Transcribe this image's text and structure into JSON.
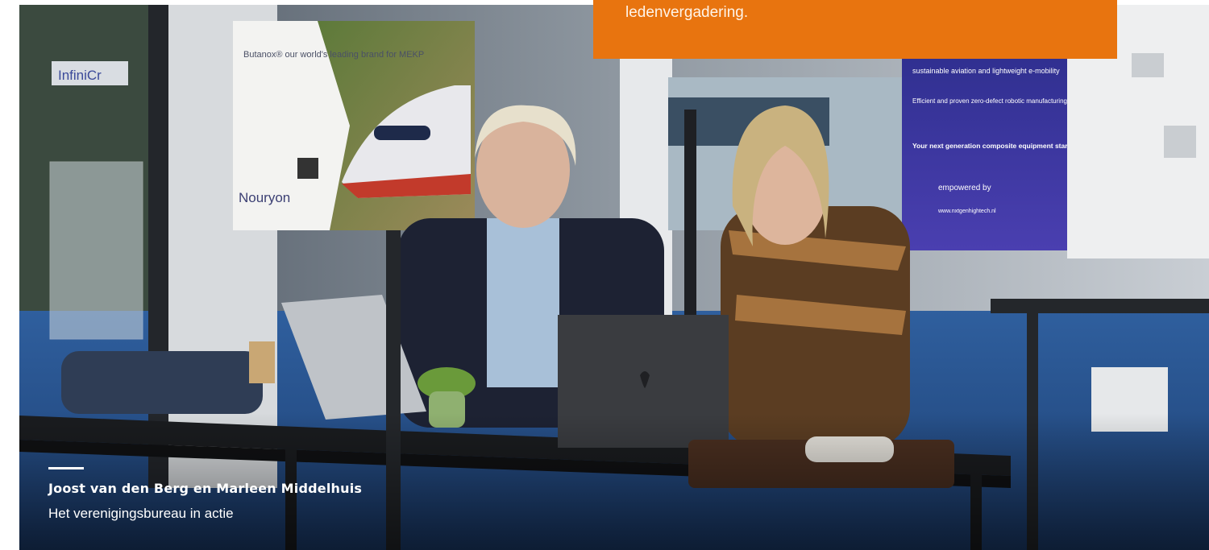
{
  "banner": {
    "text": "ledenvergadering."
  },
  "photo": {
    "nouryon_sign": {
      "headline": "Butanox® our world's leading brand for MEKP",
      "brand": "Nouryon"
    },
    "booth_panel": {
      "line1": "sustainable aviation and lightweight e-mobility",
      "line2": "Efficient and proven zero-defect robotic manufacturing",
      "tagline": "Your next generation composite equipment starts here.",
      "empowered": "empowered by",
      "url": "www.nxtgenhightech.nl"
    },
    "booth_left_sign": "InfiniCr"
  },
  "caption": {
    "title": "Joost van den Berg en Marleen Middelhuis",
    "subtitle": "Het verenigingsbureau in actie"
  },
  "colors": {
    "accent": "#e8740f",
    "caption_text": "#ffffff"
  }
}
